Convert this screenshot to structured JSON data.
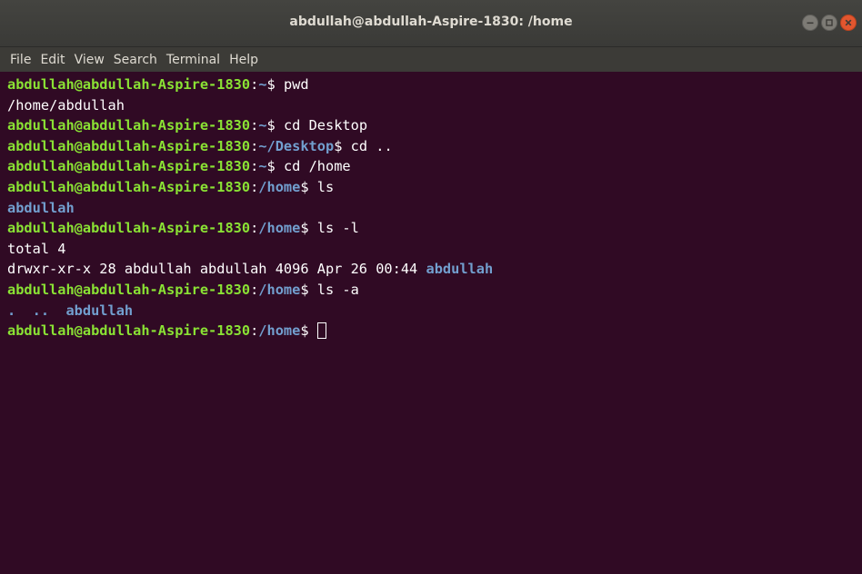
{
  "window": {
    "title": "abdullah@abdullah-Aspire-1830: /home",
    "controls": {
      "minimize_icon": "minimize-icon",
      "maximize_icon": "maximize-icon",
      "close_icon": "close-icon"
    }
  },
  "menubar": {
    "items": [
      "File",
      "Edit",
      "View",
      "Search",
      "Terminal",
      "Help"
    ]
  },
  "colors": {
    "background": "#300a24",
    "prompt_user": "#8ae234",
    "prompt_path": "#729fcf",
    "text": "#ffffff",
    "titlebar": "#3c3b37",
    "close_button": "#e2562f"
  },
  "terminal": {
    "lines": [
      {
        "type": "prompt",
        "user": "abdullah@abdullah-Aspire-1830",
        "sep": ":",
        "path": "~",
        "dollar": "$ ",
        "cmd": "pwd"
      },
      {
        "type": "output",
        "text": "/home/abdullah"
      },
      {
        "type": "prompt",
        "user": "abdullah@abdullah-Aspire-1830",
        "sep": ":",
        "path": "~",
        "dollar": "$ ",
        "cmd": "cd Desktop"
      },
      {
        "type": "prompt",
        "user": "abdullah@abdullah-Aspire-1830",
        "sep": ":",
        "path": "~/Desktop",
        "dollar": "$ ",
        "cmd": "cd .."
      },
      {
        "type": "prompt",
        "user": "abdullah@abdullah-Aspire-1830",
        "sep": ":",
        "path": "~",
        "dollar": "$ ",
        "cmd": "cd /home"
      },
      {
        "type": "prompt",
        "user": "abdullah@abdullah-Aspire-1830",
        "sep": ":",
        "path": "/home",
        "dollar": "$ ",
        "cmd": "ls"
      },
      {
        "type": "dir",
        "text": "abdullah"
      },
      {
        "type": "prompt",
        "user": "abdullah@abdullah-Aspire-1830",
        "sep": ":",
        "path": "/home",
        "dollar": "$ ",
        "cmd": "ls -l"
      },
      {
        "type": "output",
        "text": "total 4"
      },
      {
        "type": "listing",
        "text": "drwxr-xr-x 28 abdullah abdullah 4096 Apr 26 00:44 ",
        "dir": "abdullah"
      },
      {
        "type": "prompt",
        "user": "abdullah@abdullah-Aspire-1830",
        "sep": ":",
        "path": "/home",
        "dollar": "$ ",
        "cmd": "ls -a"
      },
      {
        "type": "dir",
        "text": ".  ..  abdullah"
      },
      {
        "type": "prompt",
        "user": "abdullah@abdullah-Aspire-1830",
        "sep": ":",
        "path": "/home",
        "dollar": "$ ",
        "cmd": "",
        "cursor": true
      }
    ]
  }
}
